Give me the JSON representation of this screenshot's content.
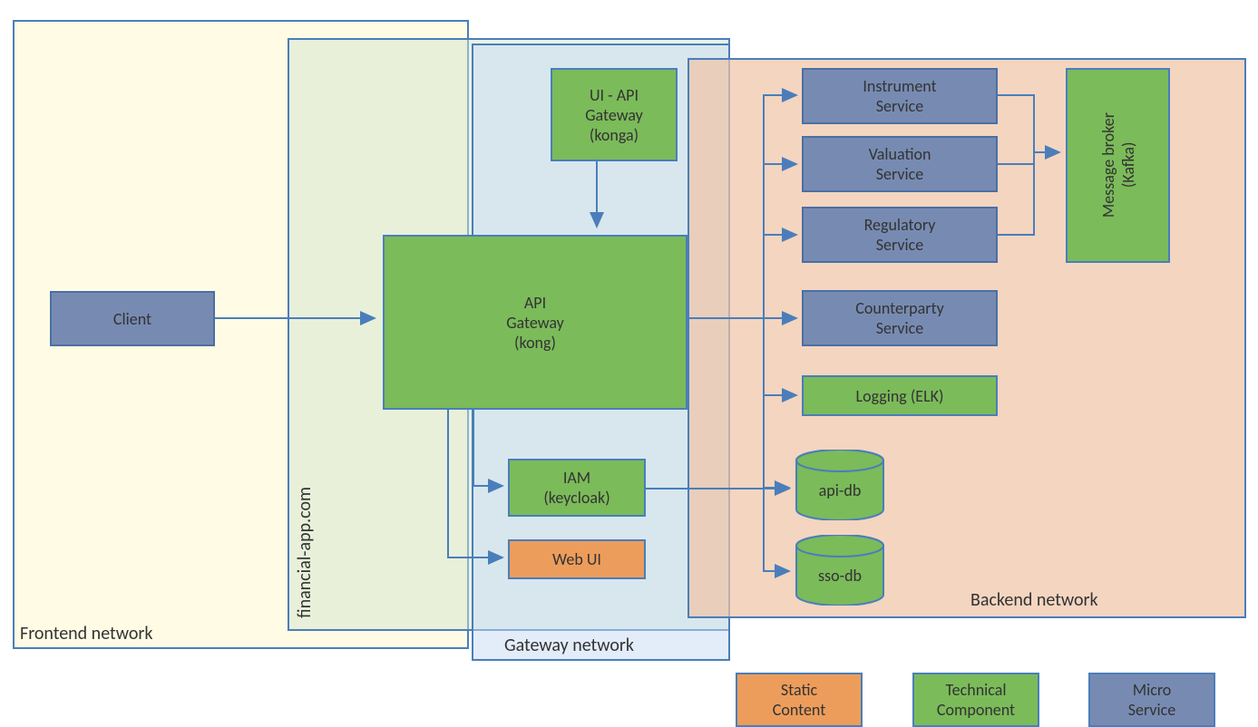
{
  "networks": {
    "frontend": "Frontend network",
    "gateway": "Gateway network",
    "backend": "Backend network"
  },
  "domain_label": "financial-app.com",
  "nodes": {
    "client": "Client",
    "ui_api_gateway_l1": "UI - API",
    "ui_api_gateway_l2": "Gateway",
    "ui_api_gateway_l3": "(konga)",
    "api_gateway_l1": "API",
    "api_gateway_l2": "Gateway",
    "api_gateway_l3": "(kong)",
    "iam_l1": "IAM",
    "iam_l2": "(keycloak)",
    "web_ui": "Web UI",
    "instrument_l1": "Instrument",
    "instrument_l2": "Service",
    "valuation_l1": "Valuation",
    "valuation_l2": "Service",
    "regulatory_l1": "Regulatory",
    "regulatory_l2": "Service",
    "counterparty_l1": "Counterparty",
    "counterparty_l2": "Service",
    "logging": "Logging (ELK)",
    "broker_l1": "Message broker",
    "broker_l2": "(Kafka)",
    "api_db": "api-db",
    "sso_db": "sso-db"
  },
  "legend": {
    "static_l1": "Static",
    "static_l2": "Content",
    "tech_l1": "Technical",
    "tech_l2": "Component",
    "micro_l1": "Micro",
    "micro_l2": "Service"
  }
}
